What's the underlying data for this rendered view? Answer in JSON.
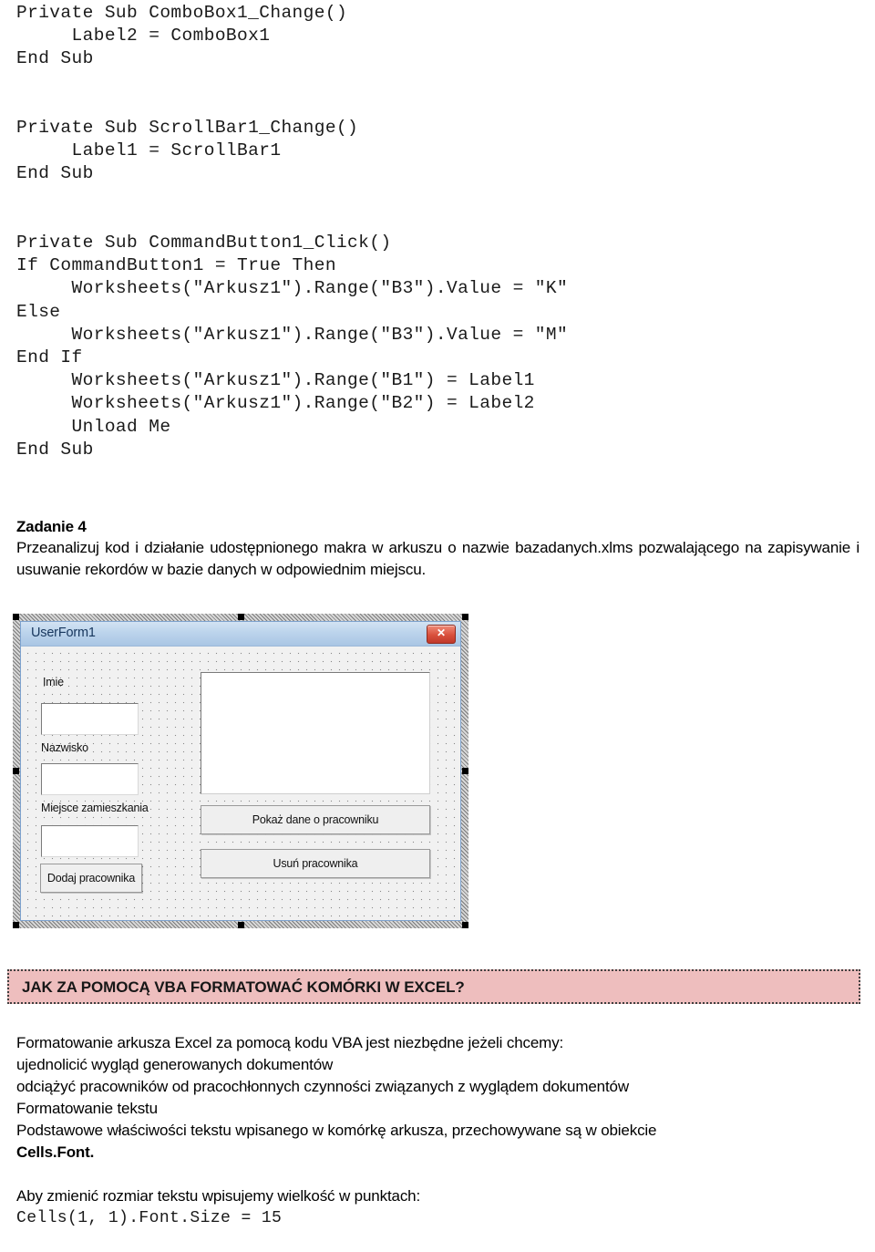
{
  "code_blocks": {
    "block1": "Private Sub ComboBox1_Change()\n     Label2 = ComboBox1\nEnd Sub",
    "block2": "Private Sub ScrollBar1_Change()\n     Label1 = ScrollBar1\nEnd Sub",
    "block3": "Private Sub CommandButton1_Click()\nIf CommandButton1 = True Then\n     Worksheets(\"Arkusz1\").Range(\"B3\").Value = \"K\"\nElse\n     Worksheets(\"Arkusz1\").Range(\"B3\").Value = \"M\"\nEnd If\n     Worksheets(\"Arkusz1\").Range(\"B1\") = Label1\n     Worksheets(\"Arkusz1\").Range(\"B2\") = Label2\n     Unload Me\nEnd Sub"
  },
  "zadanie": {
    "heading": "Zadanie 4",
    "paragraph": "Przeanalizuj kod i działanie udostępnionego makra w arkuszu o nazwie bazadanych.xlms pozwalającego na zapisywanie i usuwanie rekordów w bazie danych w odpowiednim miejscu."
  },
  "userform": {
    "title": "UserForm1",
    "close_glyph": "✕",
    "labels": {
      "imie": "Imie",
      "nazwisko": "Nazwisko",
      "miejsce": "Miejsce zamieszkania"
    },
    "buttons": {
      "dodaj": "Dodaj pracownika",
      "pokaz": "Pokaż dane o pracowniku",
      "usun": "Usuń pracownika"
    },
    "textbox_values": {
      "imie": "",
      "nazwisko": "",
      "miejsce": ""
    },
    "listbox_items": []
  },
  "banner": {
    "title": "JAK ZA POMOCĄ VBA FORMATOWAĆ KOMÓRKI W EXCEL?",
    "background_color": "#eebebe",
    "border_color": "#3f3f3f"
  },
  "body": {
    "line1": "Formatowanie arkusza Excel za pomocą kodu VBA jest niezbędne jeżeli chcemy:",
    "line2": "ujednolicić wygląd generowanych dokumentów",
    "line3": "odciążyć pracowników od pracochłonnych czynności związanych z wyglądem dokumentów",
    "line4": "Formatowanie tekstu",
    "line5": "Podstawowe właściwości tekstu wpisanego w komórkę arkusza, przechowywane są w obiekcie",
    "line6_bold": "Cells.Font.",
    "line7": "Aby zmienić rozmiar tekstu wpisujemy wielkość w punktach:",
    "line8_code": "Cells(1, 1).Font.Size = 15"
  }
}
